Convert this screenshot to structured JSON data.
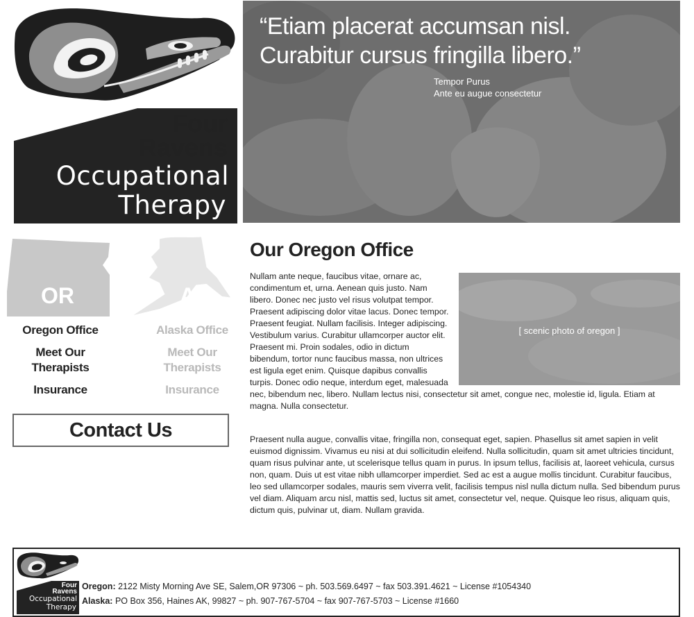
{
  "logo": {
    "line1": "Four",
    "line2": "Ravens",
    "line3": "Occupational",
    "line4": "Therapy",
    "icon": "raven-icon"
  },
  "hero": {
    "quote_line1": "“Etiam placerat accumsan nisl.",
    "quote_line2": "Curabitur cursus fringilla libero.”",
    "attribution_name": "Tempor Purus",
    "attribution_title": "Ante eu augue consectetur"
  },
  "sidebar": {
    "oregon": {
      "code": "OR",
      "office": "Oregon Office",
      "therapists_line1": "Meet Our",
      "therapists_line2": "Therapists",
      "insurance": "Insurance"
    },
    "alaska": {
      "code": "AK",
      "office": "Alaska Office",
      "therapists_line1": "Meet Our",
      "therapists_line2": "Therapists",
      "insurance": "Insurance"
    },
    "contact_label": "Contact Us"
  },
  "main": {
    "title": "Our Oregon Office",
    "photo_caption": "[ scenic photo of oregon ]",
    "paragraph1": "Nullam ante neque, faucibus vitae, ornare ac, condimentum et, urna. Aenean quis justo. Nam libero. Donec nec justo vel risus volutpat tempor. Praesent adipiscing dolor vitae lacus. Donec tempor. Praesent feugiat. Nullam facilisis. Integer adipiscing. Vestibulum varius. Curabitur ullamcorper auctor elit. Praesent mi. Proin sodales, odio in dictum bibendum, tortor nunc faucibus massa, non ultrices est ligula eget enim. Quisque dapibus convallis turpis. Donec odio neque, interdum eget, malesuada nec, bibendum nec, libero. Nullam lectus nisi, consectetur sit amet, congue nec, molestie id, ligula. Etiam at magna. Nulla consectetur.",
    "paragraph2": "Praesent nulla augue, convallis vitae, fringilla non, consequat eget, sapien. Phasellus sit amet sapien in velit euismod dignissim. Vivamus eu nisi at dui sollicitudin eleifend. Nulla sollicitudin, quam sit amet ultricies tincidunt, quam risus pulvinar ante, ut scelerisque tellus quam in purus. In ipsum tellus, facilisis at, laoreet vehicula, cursus non, quam. Duis ut est vitae nibh ullamcorper imperdiet. Sed ac est a augue mollis tincidunt. Curabitur faucibus, leo sed ullamcorper sodales, mauris sem viverra velit, facilisis tempus nisl nulla dictum nulla. Sed bibendum purus vel diam. Aliquam arcu nisl, mattis sed, luctus sit amet, consectetur vel, neque. Quisque leo risus, aliquam quis, dictum quis, pulvinar ut, diam. Nullam gravida."
  },
  "footer": {
    "oregon_label": "Oregon:",
    "oregon_text": " 2122 Misty Morning Ave SE, Salem,OR 97306 ~ ph. 503.569.6497 ~ fax 503.391.4621 ~ License #1054340",
    "alaska_label": "Alaska:",
    "alaska_text": " PO Box 356, Haines AK, 99827 ~ ph. 907-767-5704 ~ fax 907-767-5703 ~ License #1660"
  },
  "colors": {
    "dark": "#222222",
    "hero_bg": "#6f6f6f",
    "map_or": "#c8c8c8",
    "map_ak": "#e6e6e6",
    "inactive_text": "#b9b9b9"
  }
}
